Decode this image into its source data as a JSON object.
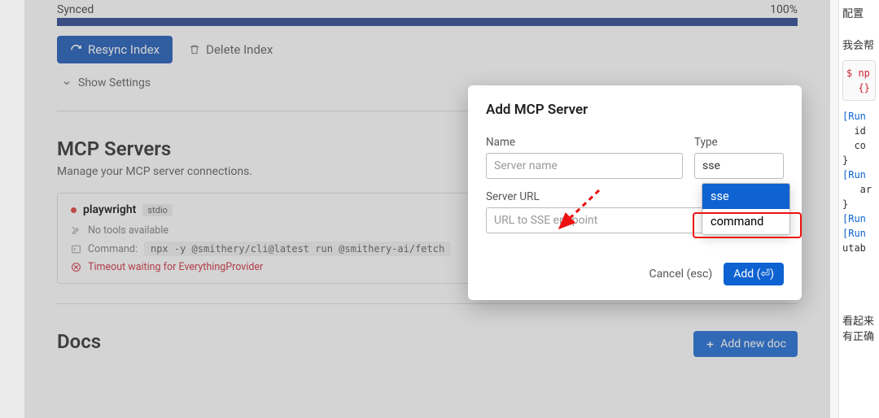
{
  "sync": {
    "status": "Synced",
    "percent": "100%"
  },
  "toolbar": {
    "resync": "Resync Index",
    "delete": "Delete Index",
    "show_settings": "Show Settings"
  },
  "mcp": {
    "title": "MCP Servers",
    "subtitle": "Manage your MCP server connections.",
    "server": {
      "name": "playwright",
      "badge": "stdio",
      "no_tools": "No tools available",
      "command_label": "Command:",
      "command": "npx -y @smithery/cli@latest run @smithery-ai/fetch",
      "error": "Timeout waiting for EverythingProvider"
    }
  },
  "docs": {
    "title": "Docs",
    "add": "Add new doc"
  },
  "modal": {
    "title": "Add MCP Server",
    "name_label": "Name",
    "name_placeholder": "Server name",
    "type_label": "Type",
    "type_value": "sse",
    "url_label": "Server URL",
    "url_placeholder": "URL to SSE endpoint",
    "cancel": "Cancel (esc)",
    "add": "Add (⏎)",
    "options": {
      "sse": "sse",
      "command": "command"
    }
  },
  "right": {
    "line1": "配置",
    "line2": "我会帮",
    "code1": "$ np",
    "code2": "  {}",
    "runs": [
      "[Run",
      "  id",
      "  co",
      "}",
      "[Run",
      "   ar",
      "}",
      "[Run",
      "[Run",
      "utab"
    ],
    "bottom1": "看起来",
    "bottom2": "有正确"
  }
}
